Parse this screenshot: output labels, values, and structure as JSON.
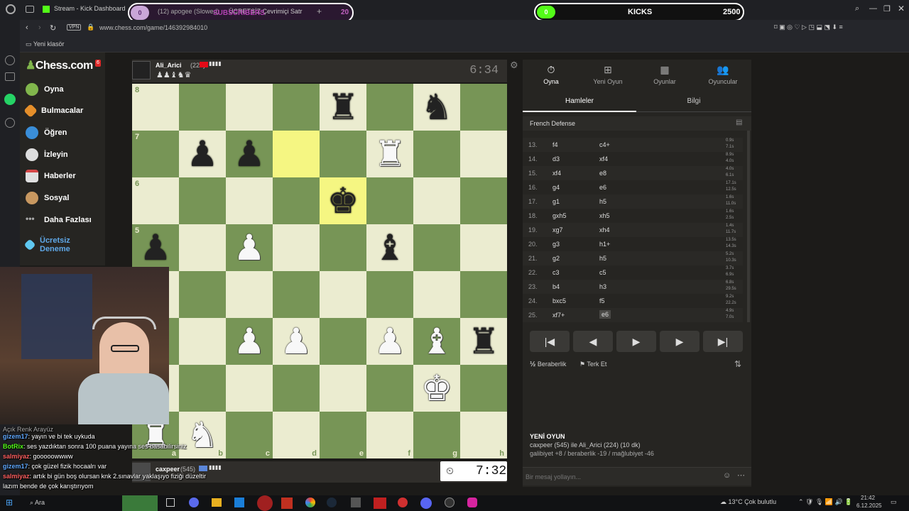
{
  "browser": {
    "tabs": [
      {
        "label": "Stream - Kick Dashboard"
      },
      {
        "label": "(12) apogee (Slowed)"
      },
      {
        "label": "ÜCRETSİZ Çevrimiçi Satr"
      }
    ],
    "url": "www.chess.com/game/146392984010",
    "vpn": "VPN",
    "bookmark": "Yeni klasör"
  },
  "overlay": {
    "subs_label": "SUBSCRIBERS",
    "subs_count": "0",
    "subs_goal": "20",
    "kicks_label": "KICKS",
    "kicks_count": "0",
    "kicks_goal": "2500"
  },
  "sidebar": {
    "logo": "Chess.com",
    "badge": "6",
    "items": [
      {
        "label": "Oyna"
      },
      {
        "label": "Bulmacalar"
      },
      {
        "label": "Öğren"
      },
      {
        "label": "İzleyin"
      },
      {
        "label": "Haberler"
      },
      {
        "label": "Sosyal"
      },
      {
        "label": "Daha Fazlası"
      },
      {
        "label": "Ücretsiz Deneme"
      }
    ]
  },
  "players": {
    "top": {
      "name": "Ali_Arici",
      "rating": "(224)",
      "clock": "6:34"
    },
    "bottom": {
      "name": "caxpeer",
      "rating": "(545)",
      "clock": "7:32"
    }
  },
  "board": {
    "files": [
      "a",
      "b",
      "c",
      "d",
      "e",
      "f",
      "g",
      "h"
    ],
    "ranks": [
      "8",
      "7",
      "6",
      "5"
    ],
    "highlight": [
      "d7",
      "e6"
    ],
    "pieces": [
      {
        "sq": "e8",
        "glyph": "♜",
        "color": "b"
      },
      {
        "sq": "g8",
        "glyph": "♞",
        "color": "b"
      },
      {
        "sq": "b7",
        "glyph": "♟",
        "color": "b"
      },
      {
        "sq": "c7",
        "glyph": "♟",
        "color": "b"
      },
      {
        "sq": "f7",
        "glyph": "♜",
        "color": "w"
      },
      {
        "sq": "e6",
        "glyph": "♚",
        "color": "b"
      },
      {
        "sq": "a5",
        "glyph": "♟",
        "color": "b"
      },
      {
        "sq": "c5",
        "glyph": "♟",
        "color": "w"
      },
      {
        "sq": "f5",
        "glyph": "♝",
        "color": "b"
      },
      {
        "sq": "c3",
        "glyph": "♟",
        "color": "w"
      },
      {
        "sq": "d3",
        "glyph": "♟",
        "color": "w"
      },
      {
        "sq": "f3",
        "glyph": "♟",
        "color": "w"
      },
      {
        "sq": "g3",
        "glyph": "♝",
        "color": "w"
      },
      {
        "sq": "h3",
        "glyph": "♜",
        "color": "b"
      },
      {
        "sq": "g2",
        "glyph": "♚",
        "color": "w"
      },
      {
        "sq": "a1",
        "glyph": "♜",
        "color": "w"
      },
      {
        "sq": "b1",
        "glyph": "♞",
        "color": "w"
      }
    ]
  },
  "panel": {
    "tabs": [
      {
        "label": "Oyna"
      },
      {
        "label": "Yeni Oyun"
      },
      {
        "label": "Oyunlar"
      },
      {
        "label": "Oyuncular"
      }
    ],
    "subtabs": [
      "Hamleler",
      "Bilgi"
    ],
    "opening": "French Defense",
    "moves": [
      {
        "n": "13.",
        "w": "f4",
        "b": "c4+",
        "wt": "0.9s",
        "bt": "7.1s"
      },
      {
        "n": "14.",
        "w": "d3",
        "b": "xf4",
        "wt": "8.9s",
        "bt": "4.0s"
      },
      {
        "n": "15.",
        "w": "xf4",
        "b": "e8",
        "wt": "4.0s",
        "bt": "6.1s"
      },
      {
        "n": "16.",
        "w": "g4",
        "b": "e6",
        "wt": "17.1s",
        "bt": "12.5s"
      },
      {
        "n": "17.",
        "w": "g1",
        "b": "h5",
        "wt": "1.6s",
        "bt": "11.0s"
      },
      {
        "n": "18.",
        "w": "gxh5",
        "b": "xh5",
        "wt": "1.6s",
        "bt": "2.5s"
      },
      {
        "n": "19.",
        "w": "xg7",
        "b": "xh4",
        "wt": "1.4s",
        "bt": "11.7s"
      },
      {
        "n": "20.",
        "w": "g3",
        "b": "h1+",
        "wt": "13.5s",
        "bt": "14.3s"
      },
      {
        "n": "21.",
        "w": "g2",
        "b": "h5",
        "wt": "5.2s",
        "bt": "10.3s"
      },
      {
        "n": "22.",
        "w": "c3",
        "b": "c5",
        "wt": "3.7s",
        "bt": "6.9s"
      },
      {
        "n": "23.",
        "w": "b4",
        "b": "h3",
        "wt": "6.8s",
        "bt": "29.5s"
      },
      {
        "n": "24.",
        "w": "bxc5",
        "b": "f5",
        "wt": "9.2s",
        "bt": "22.2s"
      },
      {
        "n": "25.",
        "w": "xf7+",
        "b": "e6",
        "wt": "4.9s",
        "bt": "7.0s"
      }
    ],
    "controls": [
      "|◀",
      "◀",
      "▶",
      "▶",
      "▶|"
    ],
    "draw": "Beraberlik",
    "resign": "Terk Et",
    "newgame_title": "YENİ OYUN",
    "newgame_line1": "caxpeer (545) ile Ali_Arici (224) (10 dk)",
    "newgame_line2": "galibiyet +8 / beraberlik -19 / mağlubiyet -46",
    "msg_placeholder": "Bir mesaj yollayın..."
  },
  "chat": [
    {
      "user": "gizem17",
      "text": ": yayın ve bi tek uykuda"
    },
    {
      "user": "BotRix",
      "text": ": ses yazdıktan sonra 100 puana yayına ses basabilirsiniz"
    },
    {
      "user": "salmiyaz",
      "text": ": gooooowwww"
    },
    {
      "user": "gizem17",
      "text": ": çok güzel fizik hocaalrı var"
    },
    {
      "user": "salmiyaz",
      "text": ": artık bi gün boş olursan knk 2.sınavlar yaklaşıyo fiziği düzeltir"
    },
    {
      "user": "",
      "text": "lazım bende de çok karıştırıyom"
    }
  ],
  "chat_header": "Açık Renk Arayüz",
  "taskbar": {
    "search": "Ara",
    "weather": "13°C Çok bulutlu",
    "time": "21:42",
    "date": "6.12.2025"
  }
}
